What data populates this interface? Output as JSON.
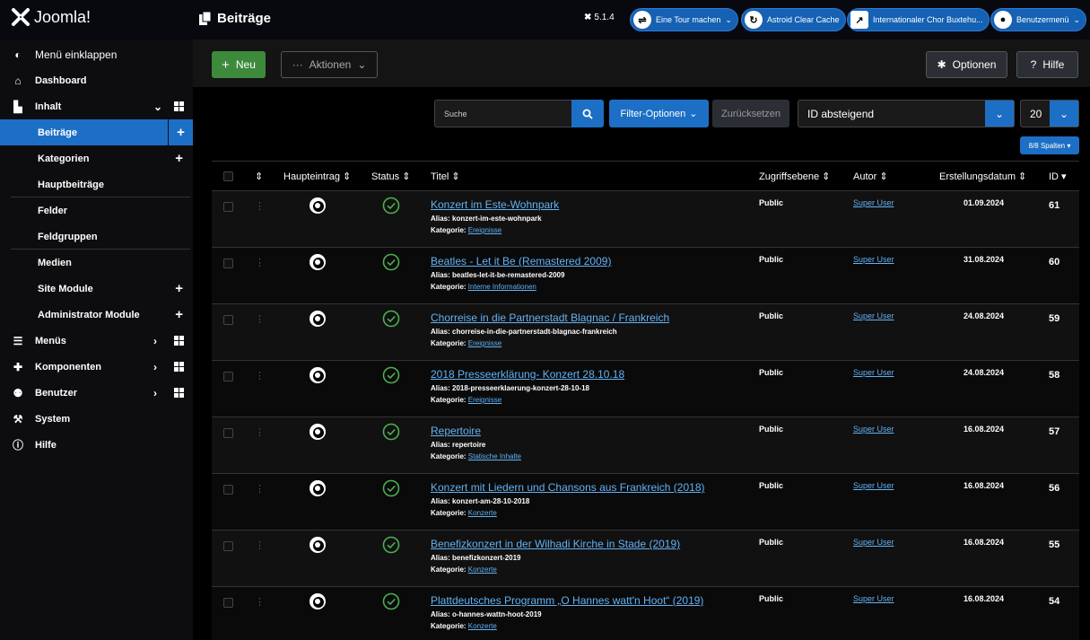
{
  "header": {
    "logo_text": "Joomla!",
    "page_title": "Beiträge",
    "version": "5.1.4",
    "pills": [
      {
        "label": "Eine Tour machen"
      },
      {
        "label": "Astroid Clear Cache"
      },
      {
        "label": "Internationaler Chor Buxtehu..."
      },
      {
        "label": "Benutzermenü"
      }
    ]
  },
  "sidebar": {
    "collapse": "Menü einklappen",
    "dashboard": "Dashboard",
    "content": "Inhalt",
    "items": [
      {
        "label": "Beiträge"
      },
      {
        "label": "Kategorien"
      },
      {
        "label": "Hauptbeiträge"
      },
      {
        "label": "Felder"
      },
      {
        "label": "Feldgruppen"
      },
      {
        "label": "Medien"
      },
      {
        "label": "Site Module"
      },
      {
        "label": "Administrator Module"
      }
    ],
    "menus": "Menüs",
    "components": "Komponenten",
    "users": "Benutzer",
    "system": "System",
    "help": "Hilfe"
  },
  "toolbar": {
    "new_label": "Neu",
    "actions_label": "Aktionen",
    "options_label": "Optionen",
    "help_label": "Hilfe"
  },
  "filters": {
    "search_placeholder": "Suche",
    "filter_options": "Filter-Optionen",
    "reset": "Zurücksetzen",
    "sort": "ID absteigend",
    "limit": "20",
    "columns": "8/8 Spalten"
  },
  "table": {
    "headers": {
      "featured": "Haupteintrag",
      "status": "Status",
      "title": "Titel",
      "access": "Zugriffsebene",
      "author": "Autor",
      "created": "Erstellungsdatum",
      "id": "ID"
    },
    "alias_prefix": "Alias:",
    "category_prefix": "Kategorie:",
    "rows": [
      {
        "title": "Konzert im Este-Wohnpark",
        "alias": "konzert-im-este-wohnpark",
        "category": "Ereignisse",
        "access": "Public",
        "author": "Super User",
        "date": "01.09.2024",
        "id": "61"
      },
      {
        "title": "Beatles - Let it Be (Remastered 2009)",
        "alias": "beatles-let-it-be-remastered-2009",
        "category": "Interne Informationen",
        "access": "Public",
        "author": "Super User",
        "date": "31.08.2024",
        "id": "60"
      },
      {
        "title": "Chorreise in die Partnerstadt Blagnac / Frankreich",
        "alias": "chorreise-in-die-partnerstadt-blagnac-frankreich",
        "category": "Ereignisse",
        "access": "Public",
        "author": "Super User",
        "date": "24.08.2024",
        "id": "59"
      },
      {
        "title": "2018 Presseerklärung- Konzert 28.10.18",
        "alias": "2018-presseerklaerung-konzert-28-10-18",
        "category": "Ereignisse",
        "access": "Public",
        "author": "Super User",
        "date": "24.08.2024",
        "id": "58"
      },
      {
        "title": "Repertoire",
        "alias": "repertoire",
        "category": "Statische Inhalte",
        "access": "Public",
        "author": "Super User",
        "date": "16.08.2024",
        "id": "57"
      },
      {
        "title": "Konzert mit Liedern und Chansons aus Frankreich (2018)",
        "alias": "konzert-am-28-10-2018",
        "category": "Konzerte",
        "access": "Public",
        "author": "Super User",
        "date": "16.08.2024",
        "id": "56"
      },
      {
        "title": "Benefizkonzert in der Wilhadi Kirche in Stade (2019)",
        "alias": "benefizkonzert-2019",
        "category": "Konzerte",
        "access": "Public",
        "author": "Super User",
        "date": "16.08.2024",
        "id": "55"
      },
      {
        "title": "Plattdeutsches Programm „O Hannes watt'n Hoot“ (2019)",
        "alias": "o-hannes-wattn-hoot-2019",
        "category": "Konzerte",
        "access": "Public",
        "author": "Super User",
        "date": "16.08.2024",
        "id": "54"
      }
    ]
  }
}
